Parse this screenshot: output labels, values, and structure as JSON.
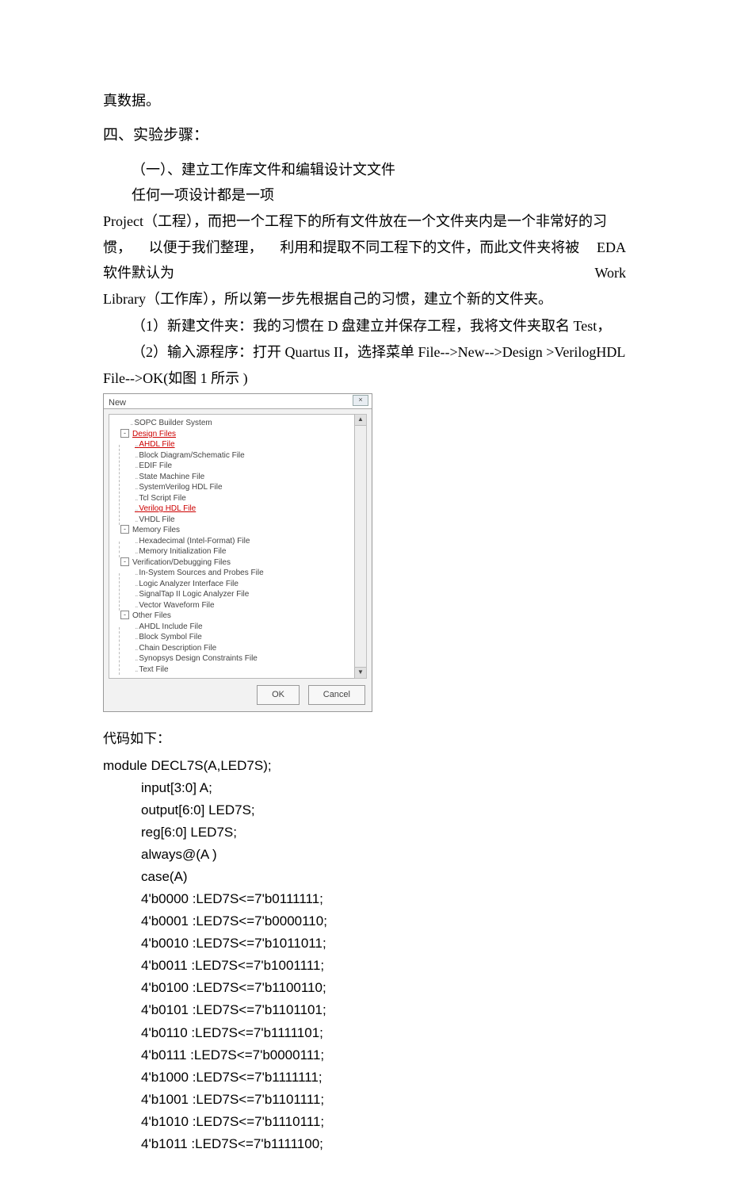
{
  "intro": {
    "l1": "真数据。",
    "h4": "四、实验步骤：",
    "s1": "（一）、建立工作库文件和编辑设计文文件",
    "p1_a": "任何一项设计都是一项",
    "p2_a": "Project（工程），而把一个工程下的所有文件放在一个文件夹内是一个非常好的习",
    "p2_b_left": "惯，",
    "p2_b_mid": "以便于我们整理，",
    "p2_b_right": "利用和提取不同工程下的文件，而此文件夹将被",
    "p2_b_end": "EDA",
    "p2_c_left": "软件默认为",
    "p2_c_right": "Work",
    "p2_d": "Library（工作库），所以第一步先根据自己的习惯，建立个新的文件夹。",
    "step1": "（1）新建文件夹：我的习惯在  D 盘建立并保存工程，我将文件夹取名  Test，",
    "step2": "（2）输入源程序：打开 Quartus II，选择菜单 File-->New-->Design >VerilogHDL",
    "step2b": "File-->OK(如图 1 所示 )"
  },
  "dialog": {
    "title": "New",
    "close": "×",
    "top_item": "SOPC Builder System",
    "groups": [
      {
        "label": "Design Files",
        "items": [
          "AHDL File",
          "Block Diagram/Schematic File",
          "EDIF File",
          "State Machine File",
          "SystemVerilog HDL File",
          "Tcl Script File",
          "Verilog HDL File",
          "VHDL File"
        ]
      },
      {
        "label": "Memory Files",
        "items": [
          "Hexadecimal (Intel-Format) File",
          "Memory Initialization File"
        ]
      },
      {
        "label": "Verification/Debugging Files",
        "items": [
          "In-System Sources and Probes File",
          "Logic Analyzer Interface File",
          "SignalTap II Logic Analyzer File",
          "Vector Waveform File"
        ]
      },
      {
        "label": "Other Files",
        "items": [
          "AHDL Include File",
          "Block Symbol File",
          "Chain Description File",
          "Synopsys Design Constraints File",
          "Text File"
        ]
      }
    ],
    "ok": "OK",
    "cancel": "Cancel",
    "up": "▲",
    "down": "▼"
  },
  "code": {
    "lead": "代码如下：",
    "l0": "module DECL7S(A,LED7S);",
    "l1": "input[3:0] A;",
    "l2": "output[6:0] LED7S;",
    "l3": "reg[6:0] LED7S;",
    "l4": "always@(A )",
    "l5": "case(A)",
    "l6": "4'b0000 :LED7S<=7'b0111111;",
    "l7": "4'b0001 :LED7S<=7'b0000110;",
    "l8": "4'b0010 :LED7S<=7'b1011011;",
    "l9": "4'b0011 :LED7S<=7'b1001111;",
    "l10": "4'b0100 :LED7S<=7'b1100110;",
    "l11": "4'b0101 :LED7S<=7'b1101101;",
    "l12": "4'b0110 :LED7S<=7'b1111101;",
    "l13": "4'b0111 :LED7S<=7'b0000111;",
    "l14": "4'b1000 :LED7S<=7'b1111111;",
    "l15": "4'b1001 :LED7S<=7'b1101111;",
    "l16": "4'b1010 :LED7S<=7'b1110111;",
    "l17": "4'b1011 :LED7S<=7'b1111100;"
  }
}
